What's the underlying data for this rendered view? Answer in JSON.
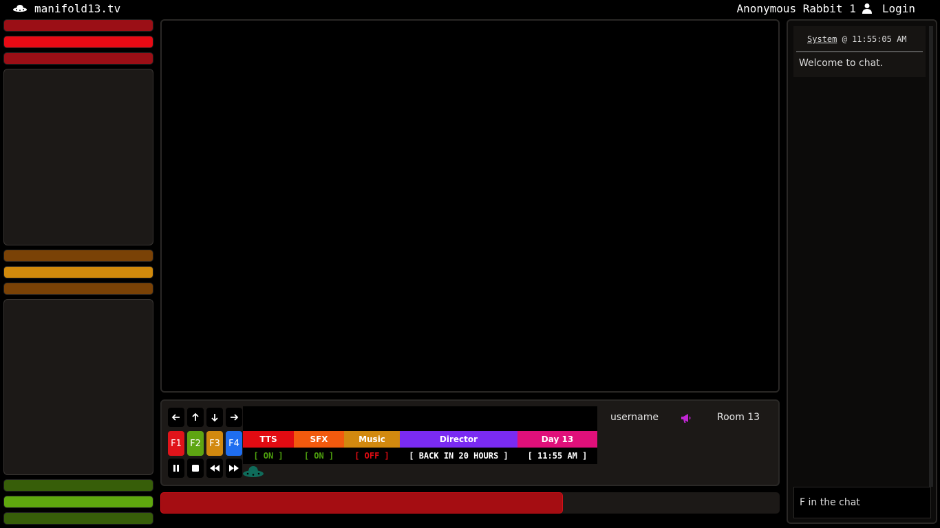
{
  "header": {
    "site_name": "manifold13.tv",
    "user_name": "Anonymous Rabbit 1",
    "login_label": "Login"
  },
  "left": {
    "bar_colors": [
      "#9b0f16",
      "#e80a14",
      "#9b0f16",
      "#7a4206",
      "#d18a0c",
      "#7a4206",
      "#375e09",
      "#5fa80e",
      "#375e09"
    ]
  },
  "controls": {
    "fkeys": [
      "F1",
      "F2",
      "F3",
      "F4"
    ],
    "fkey_colors": [
      "#e0141a",
      "#5ea512",
      "#d2890f",
      "#1f6ef0"
    ],
    "status": [
      {
        "label": "TTS",
        "value": "[ ON ]",
        "color": "#e20b12",
        "value_color": "#4ea10e"
      },
      {
        "label": "SFX",
        "value": "[ ON ]",
        "color": "#f25a0e",
        "value_color": "#4ea10e"
      },
      {
        "label": "Music",
        "value": "[ OFF ]",
        "color": "#d2890f",
        "value_color": "#e20b12"
      },
      {
        "label": "Director",
        "value": "[ BACK IN 20 HOURS ]",
        "color": "#7a2bf2",
        "value_color": "#ffffff"
      },
      {
        "label": "Day 13",
        "value": "[ 11:55 AM ]",
        "color": "#e0107a",
        "value_color": "#ffffff"
      }
    ],
    "username": "username",
    "room": "Room 13",
    "accent_color": "#c026d3"
  },
  "progress": {
    "fraction": 0.65
  },
  "chat": {
    "message": {
      "user": "System",
      "separator": "@",
      "time": "11:55:05 AM",
      "text": "Welcome to chat."
    },
    "input_value": "F in the chat"
  }
}
